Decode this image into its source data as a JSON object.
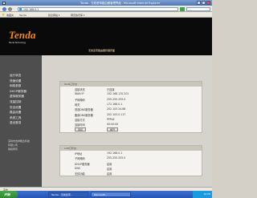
{
  "window": {
    "title": "Tenda - 无线宽带路由器管理界面 - Microsoft Internet Explorer"
  },
  "address_bar": {
    "url": "192.168.0.1"
  },
  "favorites_bar": {
    "items": [
      "收藏夹",
      "Tenda",
      "建议网站 ▾",
      "网页快讯库 ▾"
    ]
  },
  "header": {
    "logo": "Tenda",
    "logo_sub": "Tenda Technology",
    "tagline": "无线宽带路由器管理界面"
  },
  "sidebar": {
    "menu": [
      "运行状态",
      "快速设置",
      "网络参数",
      "DHCP服务器",
      "虚拟服务器",
      "流量控制",
      "安全设置",
      "路由设置",
      "系统工具",
      "退出登录"
    ],
    "note": [
      "深圳市吉祥腾达科技",
      "有限公司",
      "版权所有"
    ]
  },
  "panels": {
    "wan": {
      "title": "WAN口状态",
      "rows": [
        {
          "key": "连接状态",
          "value": "已连接"
        },
        {
          "key": "WAN IP",
          "value": "192.168.170.201"
        },
        {
          "key": "子网掩码",
          "value": "255.255.255.0"
        },
        {
          "key": "网关",
          "value": "172.168.0.1"
        },
        {
          "key": "首选DNS服务器",
          "value": "202.103.24.68"
        },
        {
          "key": "备用DNS服务器",
          "value": "202.103.0.117"
        },
        {
          "key": "连接方式",
          "value": "PPPoE"
        },
        {
          "key": "连接时间",
          "value": "00:00:00"
        }
      ],
      "buttons": [
        "连接",
        "断开"
      ]
    },
    "lan": {
      "title": "LAN口状态",
      "rows": [
        {
          "key": "IP地址",
          "value": "192.168.0.1"
        },
        {
          "key": "子网掩码",
          "value": "255.255.255.0"
        },
        {
          "key": "DHCP服务器",
          "value": "启用"
        },
        {
          "key": "DNS",
          "value": "启用"
        },
        {
          "key": "无线功能",
          "value": "启用"
        }
      ]
    }
  },
  "statusbar": {
    "text": "完毕"
  },
  "taskbar": {
    "start": "开始",
    "buttons": [
      "Tenda - 无线宽带...",
      "Microsoft..."
    ],
    "clock": "10:28"
  },
  "colors": {
    "brand_orange": "#f08b1a",
    "header_bg": "#0a0a0a",
    "sidebar_bg": "#4e4e4e",
    "content_bg": "#d6d3cc",
    "taskbar_blue": "#2455b6"
  }
}
